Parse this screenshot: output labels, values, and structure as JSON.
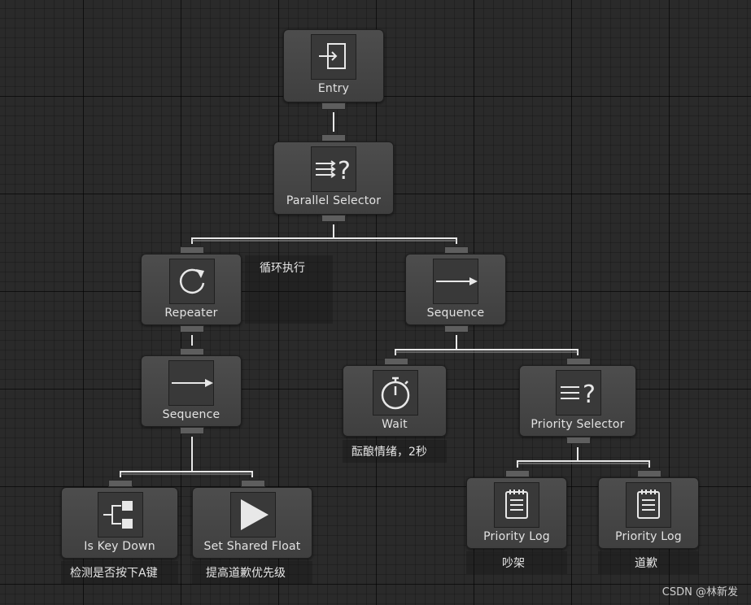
{
  "nodes": {
    "entry": {
      "label": "Entry",
      "icon": "entry-icon"
    },
    "parallel_selector": {
      "label": "Parallel Selector",
      "icon": "parallel-selector-icon"
    },
    "repeater": {
      "label": "Repeater",
      "icon": "repeat-icon"
    },
    "sequence_right": {
      "label": "Sequence",
      "icon": "arrow-right-icon"
    },
    "sequence_left": {
      "label": "Sequence",
      "icon": "arrow-right-icon"
    },
    "wait": {
      "label": "Wait",
      "icon": "stopwatch-icon"
    },
    "priority_selector": {
      "label": "Priority Selector",
      "icon": "priority-selector-icon"
    },
    "is_key_down": {
      "label": "Is Key Down",
      "icon": "conditional-branch-icon"
    },
    "set_shared_float": {
      "label": "Set Shared Float",
      "icon": "play-icon"
    },
    "priority_log_1": {
      "label": "Priority Log",
      "icon": "log-notepad-icon"
    },
    "priority_log_2": {
      "label": "Priority Log",
      "icon": "log-notepad-icon"
    }
  },
  "comments": {
    "repeater": "循环执行",
    "wait": "酝酿情绪，2秒",
    "is_key_down": "检测是否按下A键",
    "set_shared_float": "提高道歉优先级",
    "priority_log_1": "吵架",
    "priority_log_2": "道歉"
  },
  "watermark": "CSDN @林新发",
  "colors": {
    "background": "#2a2a2a",
    "node": "#464646",
    "edge": "#e8e8e8"
  }
}
